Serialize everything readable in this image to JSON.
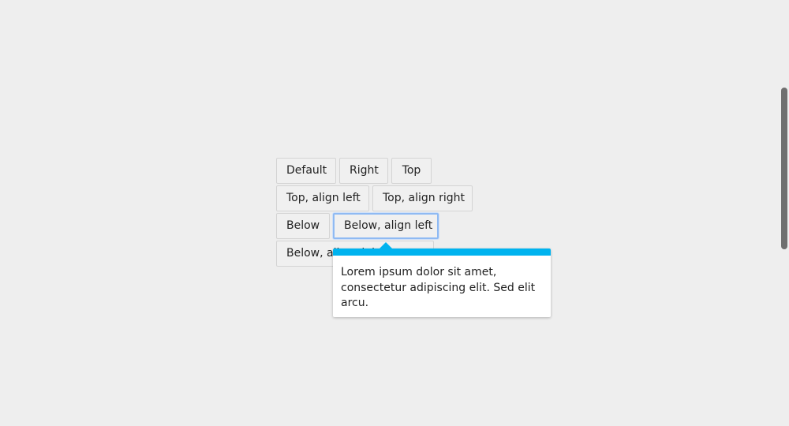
{
  "buttons": {
    "default": "Default",
    "right": "Right",
    "top": "Top",
    "top_align_left": "Top, align left",
    "top_align_right": "Top, align right",
    "below": "Below",
    "below_align_left": "Below, align left",
    "below_align_right": "Below, align right"
  },
  "popover": {
    "text": "Lorem ipsum dolor sit amet, consectetur adipiscing elit. Sed elit arcu.",
    "accent_color": "#00b3ef"
  },
  "focused_button": "Below, align left"
}
